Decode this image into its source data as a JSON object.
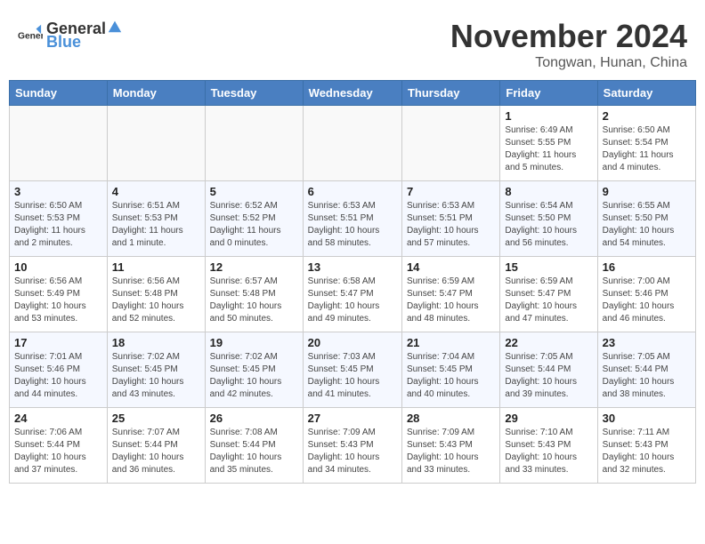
{
  "header": {
    "logo_general": "General",
    "logo_blue": "Blue",
    "month": "November 2024",
    "location": "Tongwan, Hunan, China"
  },
  "weekdays": [
    "Sunday",
    "Monday",
    "Tuesday",
    "Wednesday",
    "Thursday",
    "Friday",
    "Saturday"
  ],
  "weeks": [
    [
      {
        "day": "",
        "info": ""
      },
      {
        "day": "",
        "info": ""
      },
      {
        "day": "",
        "info": ""
      },
      {
        "day": "",
        "info": ""
      },
      {
        "day": "",
        "info": ""
      },
      {
        "day": "1",
        "info": "Sunrise: 6:49 AM\nSunset: 5:55 PM\nDaylight: 11 hours\nand 5 minutes."
      },
      {
        "day": "2",
        "info": "Sunrise: 6:50 AM\nSunset: 5:54 PM\nDaylight: 11 hours\nand 4 minutes."
      }
    ],
    [
      {
        "day": "3",
        "info": "Sunrise: 6:50 AM\nSunset: 5:53 PM\nDaylight: 11 hours\nand 2 minutes."
      },
      {
        "day": "4",
        "info": "Sunrise: 6:51 AM\nSunset: 5:53 PM\nDaylight: 11 hours\nand 1 minute."
      },
      {
        "day": "5",
        "info": "Sunrise: 6:52 AM\nSunset: 5:52 PM\nDaylight: 11 hours\nand 0 minutes."
      },
      {
        "day": "6",
        "info": "Sunrise: 6:53 AM\nSunset: 5:51 PM\nDaylight: 10 hours\nand 58 minutes."
      },
      {
        "day": "7",
        "info": "Sunrise: 6:53 AM\nSunset: 5:51 PM\nDaylight: 10 hours\nand 57 minutes."
      },
      {
        "day": "8",
        "info": "Sunrise: 6:54 AM\nSunset: 5:50 PM\nDaylight: 10 hours\nand 56 minutes."
      },
      {
        "day": "9",
        "info": "Sunrise: 6:55 AM\nSunset: 5:50 PM\nDaylight: 10 hours\nand 54 minutes."
      }
    ],
    [
      {
        "day": "10",
        "info": "Sunrise: 6:56 AM\nSunset: 5:49 PM\nDaylight: 10 hours\nand 53 minutes."
      },
      {
        "day": "11",
        "info": "Sunrise: 6:56 AM\nSunset: 5:48 PM\nDaylight: 10 hours\nand 52 minutes."
      },
      {
        "day": "12",
        "info": "Sunrise: 6:57 AM\nSunset: 5:48 PM\nDaylight: 10 hours\nand 50 minutes."
      },
      {
        "day": "13",
        "info": "Sunrise: 6:58 AM\nSunset: 5:47 PM\nDaylight: 10 hours\nand 49 minutes."
      },
      {
        "day": "14",
        "info": "Sunrise: 6:59 AM\nSunset: 5:47 PM\nDaylight: 10 hours\nand 48 minutes."
      },
      {
        "day": "15",
        "info": "Sunrise: 6:59 AM\nSunset: 5:47 PM\nDaylight: 10 hours\nand 47 minutes."
      },
      {
        "day": "16",
        "info": "Sunrise: 7:00 AM\nSunset: 5:46 PM\nDaylight: 10 hours\nand 46 minutes."
      }
    ],
    [
      {
        "day": "17",
        "info": "Sunrise: 7:01 AM\nSunset: 5:46 PM\nDaylight: 10 hours\nand 44 minutes."
      },
      {
        "day": "18",
        "info": "Sunrise: 7:02 AM\nSunset: 5:45 PM\nDaylight: 10 hours\nand 43 minutes."
      },
      {
        "day": "19",
        "info": "Sunrise: 7:02 AM\nSunset: 5:45 PM\nDaylight: 10 hours\nand 42 minutes."
      },
      {
        "day": "20",
        "info": "Sunrise: 7:03 AM\nSunset: 5:45 PM\nDaylight: 10 hours\nand 41 minutes."
      },
      {
        "day": "21",
        "info": "Sunrise: 7:04 AM\nSunset: 5:45 PM\nDaylight: 10 hours\nand 40 minutes."
      },
      {
        "day": "22",
        "info": "Sunrise: 7:05 AM\nSunset: 5:44 PM\nDaylight: 10 hours\nand 39 minutes."
      },
      {
        "day": "23",
        "info": "Sunrise: 7:05 AM\nSunset: 5:44 PM\nDaylight: 10 hours\nand 38 minutes."
      }
    ],
    [
      {
        "day": "24",
        "info": "Sunrise: 7:06 AM\nSunset: 5:44 PM\nDaylight: 10 hours\nand 37 minutes."
      },
      {
        "day": "25",
        "info": "Sunrise: 7:07 AM\nSunset: 5:44 PM\nDaylight: 10 hours\nand 36 minutes."
      },
      {
        "day": "26",
        "info": "Sunrise: 7:08 AM\nSunset: 5:44 PM\nDaylight: 10 hours\nand 35 minutes."
      },
      {
        "day": "27",
        "info": "Sunrise: 7:09 AM\nSunset: 5:43 PM\nDaylight: 10 hours\nand 34 minutes."
      },
      {
        "day": "28",
        "info": "Sunrise: 7:09 AM\nSunset: 5:43 PM\nDaylight: 10 hours\nand 33 minutes."
      },
      {
        "day": "29",
        "info": "Sunrise: 7:10 AM\nSunset: 5:43 PM\nDaylight: 10 hours\nand 33 minutes."
      },
      {
        "day": "30",
        "info": "Sunrise: 7:11 AM\nSunset: 5:43 PM\nDaylight: 10 hours\nand 32 minutes."
      }
    ]
  ]
}
